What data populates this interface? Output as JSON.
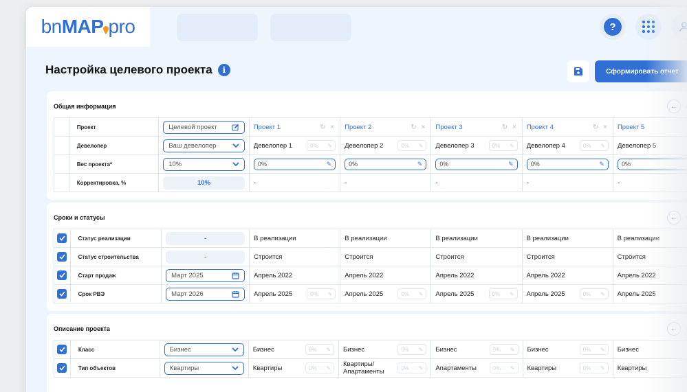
{
  "logo": {
    "part1": "bn",
    "part2": "MAP",
    "part3": "pro"
  },
  "header": {
    "help": "?"
  },
  "page": {
    "title": "Настройка целевого проекта",
    "info": "i",
    "report_button": "Сформировать отчет"
  },
  "general": {
    "title": "Общая информация",
    "rows": [
      {
        "label": "Проект",
        "input": "Целевой проект",
        "input_icon": "edit-icon"
      },
      {
        "label": "Девелопер",
        "input": "Ваш девелопер",
        "input_icon": "chevron-down-icon"
      },
      {
        "label": "Вес проекта*",
        "input": "10%",
        "input_icon": "chevron-down-icon"
      },
      {
        "label": "Корректировка, %",
        "input": "10%"
      }
    ],
    "projects": [
      {
        "name": "Проект 1",
        "developer": "Девелопер 1",
        "weight": "0%",
        "correction": "-"
      },
      {
        "name": "Проект 2",
        "developer": "Девелопер 2",
        "weight": "0%",
        "correction": "-"
      },
      {
        "name": "Проект 3",
        "developer": "Девелопер 3",
        "weight": "0%",
        "correction": "-"
      },
      {
        "name": "Проект 4",
        "developer": "Девелопер 4",
        "weight": "0%",
        "correction": "-"
      },
      {
        "name": "Проект 5",
        "developer": "Девелопер 5",
        "weight": "0%",
        "correction": "-"
      }
    ],
    "mini_pct": "0%"
  },
  "timing": {
    "title": "Сроки и статусы",
    "rows": [
      {
        "label": "Статус реализации",
        "input": "-",
        "values": [
          "В реализации",
          "В реализации",
          "В реализации",
          "В реализации",
          "В реализации"
        ],
        "mini": false
      },
      {
        "label": "Статус строительства",
        "input": "-",
        "values": [
          "Строится",
          "Строится",
          "Строится",
          "Строится",
          "Строится"
        ],
        "mini": false
      },
      {
        "label": "Старт продаж",
        "input": "Март 2025",
        "values": [
          "Апрель 2022",
          "Апрель 2022",
          "Апрель 2022",
          "Апрель 2022",
          "Апрель 2022"
        ],
        "mini": false
      },
      {
        "label": "Срок РВЭ",
        "input": "Март 2026",
        "values": [
          "Апрель 2025",
          "Апрель 2025",
          "Апрель 2025",
          "Апрель 2025",
          "Апрель 2025"
        ],
        "mini": true
      }
    ]
  },
  "description": {
    "title": "Описание проекта",
    "rows": [
      {
        "label": "Класс",
        "input": "Бизнес",
        "values": [
          "Бизнес",
          "Бизнес",
          "Бизнес",
          "Бизнес",
          "Бизнес"
        ]
      },
      {
        "label": "Тип объектов",
        "input": "Квартиры",
        "values": [
          "Квартиры",
          "Квартиры/ Апартаменты",
          "Апартаменты",
          "Квартиры",
          "Квартиры"
        ]
      }
    ]
  },
  "colors": {
    "accent": "#2f6fd6",
    "panel": "#eef5fc"
  }
}
